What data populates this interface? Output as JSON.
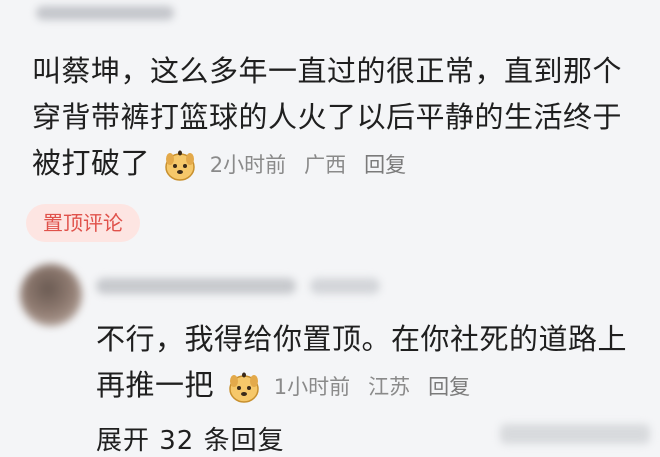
{
  "top_comment": {
    "text": "叫蔡坤，这么多年一直过的很正常，直到那个穿背带裤打篮球的人火了以后平静的生活终于被打破了",
    "emoji": "dog-face-emoji-icon",
    "time": "2小时前",
    "location": "广西",
    "reply_label": "回复",
    "pinned_label": "置顶评论"
  },
  "reply_comment": {
    "text": "不行，我得给你置顶。在你社死的道路上再推一把",
    "emoji": "dog-face-emoji-icon",
    "time": "1小时前",
    "location": "江苏",
    "reply_label": "回复"
  },
  "expand_label": "展开 32 条回复",
  "colors": {
    "background": "#f4f5f7",
    "pin_badge_bg": "#fde5e2",
    "pin_badge_text": "#e0524b",
    "meta_text": "#8a8a8a"
  }
}
